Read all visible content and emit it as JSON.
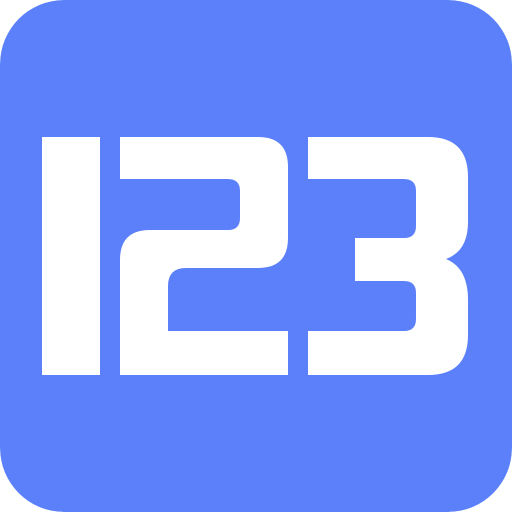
{
  "icon": {
    "text": "123",
    "background_color": "#5b80fa",
    "glyph_color": "#ffffff"
  }
}
